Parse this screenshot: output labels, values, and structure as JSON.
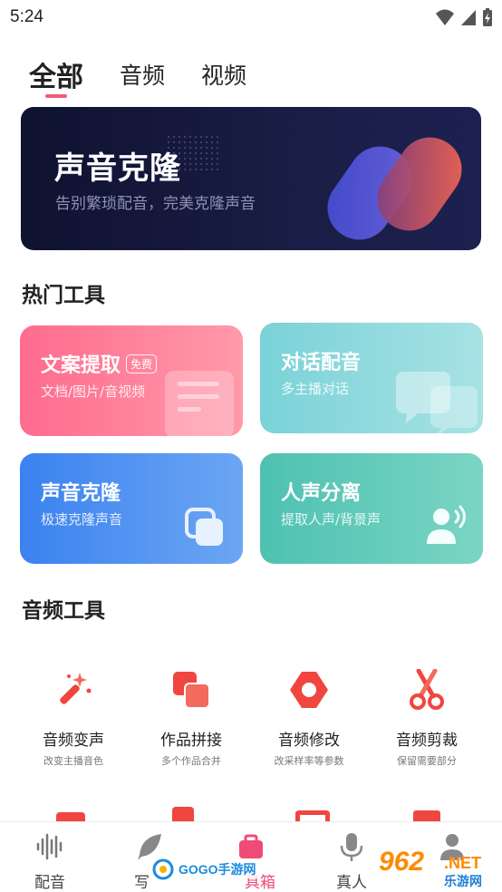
{
  "status_bar": {
    "time": "5:24",
    "icons": [
      "wifi-icon",
      "signal-icon",
      "battery-charging-icon"
    ]
  },
  "tabs": [
    {
      "label": "全部",
      "active": true
    },
    {
      "label": "音频",
      "active": false
    },
    {
      "label": "视频",
      "active": false
    }
  ],
  "banner": {
    "title": "声音克隆",
    "subtitle": "告别繁琐配音，完美克隆声音"
  },
  "hot_tools": {
    "title": "热门工具",
    "cards": [
      {
        "title": "文案提取",
        "badge": "免费",
        "subtitle": "文档/图片/音视频",
        "icon": "document-icon",
        "colors": [
          "#ff6b8e",
          "#ff93a6"
        ]
      },
      {
        "title": "对话配音",
        "subtitle": "多主播对话",
        "icon": "chat-bubbles-icon",
        "colors": [
          "#7ed3d8",
          "#a8e1e3"
        ]
      },
      {
        "title": "声音克隆",
        "subtitle": "极速克隆声音",
        "icon": "copy-icon",
        "colors": [
          "#3b82f0",
          "#6aa3f2"
        ]
      },
      {
        "title": "人声分离",
        "subtitle": "提取人声/背景声",
        "icon": "person-voice-icon",
        "colors": [
          "#4ec2b0",
          "#7ad3c2"
        ]
      }
    ]
  },
  "audio_tools": {
    "title": "音频工具",
    "items": [
      {
        "label": "音频变声",
        "desc": "改变主播音色",
        "icon": "magic-wand-icon"
      },
      {
        "label": "作品拼接",
        "desc": "多个作品合并",
        "icon": "stack-squares-icon"
      },
      {
        "label": "音频修改",
        "desc": "改采样率等参数",
        "icon": "hexagon-nut-icon"
      },
      {
        "label": "音频剪裁",
        "desc": "保留需要部分",
        "icon": "scissors-icon"
      }
    ]
  },
  "bottom_nav": [
    {
      "label": "配音",
      "icon": "waveform-icon",
      "active": false
    },
    {
      "label": "写",
      "icon": "feather-icon",
      "active": false
    },
    {
      "label": "具箱",
      "icon": "toolbox-icon",
      "active": true
    },
    {
      "label": "真人",
      "icon": "microphone-icon",
      "active": false
    },
    {
      "label": "",
      "icon": "profile-icon",
      "active": false
    }
  ],
  "watermarks": {
    "left": "GOGO手游网",
    "right_num": "962",
    "right_net": ".NET",
    "right_cn": "乐游网"
  },
  "colors": {
    "accent": "#f04a78",
    "banner_bg": "#141739"
  }
}
